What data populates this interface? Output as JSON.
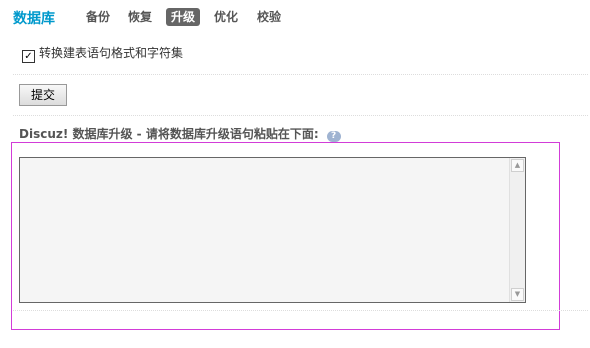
{
  "header": {
    "title": "数据库",
    "tabs": [
      {
        "label": "备份"
      },
      {
        "label": "恢复"
      },
      {
        "label": "升级",
        "active": true
      },
      {
        "label": "优化"
      },
      {
        "label": "校验"
      }
    ]
  },
  "options": {
    "convert_label": "转换建表语句格式和字符集",
    "convert_checked": true,
    "check_mark": "✓"
  },
  "form": {
    "submit_label": "提交",
    "heading": "Discuz! 数据库升级 - 请将数据库升级语句粘贴在下面:",
    "help_icon": "?",
    "textarea_value": ""
  },
  "colors": {
    "accent": "#0099cc",
    "active_tab_bg": "#666666",
    "highlight_border": "#d23cd8"
  },
  "icons": {
    "help": "help-icon",
    "scroll_up": "chevron-up-icon",
    "scroll_down": "chevron-down-icon"
  }
}
